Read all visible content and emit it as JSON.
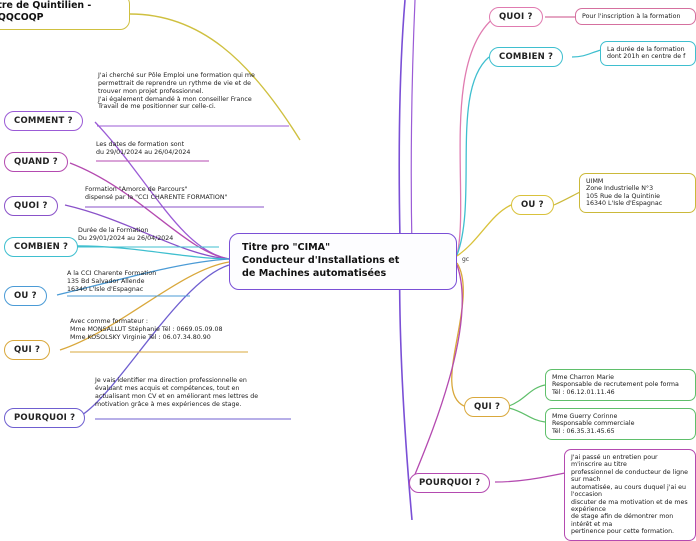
{
  "diagram": {
    "root": {
      "text": "ètre de Quintilien -\n  CQQCOQP"
    },
    "central": {
      "text": "Titre pro \"CIMA\"\nConducteur d'Installations et\nde Machines automatisées"
    },
    "marker": {
      "text": "gc"
    },
    "left_branches": [
      {
        "label": "COMMENT ?",
        "color": "#9b5bd6",
        "detail": "J'ai cherché sur Pôle Emploi une formation qui me\npermettrait de reprendre un rythme de vie et de\ntrouver mon projet professionnel.\nJ'ai également demandé à mon conseiller France\nTravail de me positionner sur celle-ci."
      },
      {
        "label": "QUAND ?",
        "color": "#b44ab0",
        "detail": "Les dates de formation sont\ndu 29/01/2024 au 26/04/2024"
      },
      {
        "label": "QUOI ?",
        "color": "#8a52c9",
        "detail": "Formation \"Amorce de Parcours\"\ndispensé par la \"CCI CHARENTE FORMATION\""
      },
      {
        "label": "COMBIEN ?",
        "color": "#3fbfcf",
        "detail": "Durée de la Formation\nDu 29/01/2024 au 26/04/2024"
      },
      {
        "label": "OU ?",
        "color": "#4b9bd6",
        "detail": "A la CCI Charente Formation\n135 Bd Salvador Allende\n16340 L'Isle d'Espagnac"
      },
      {
        "label": "QUI ?",
        "color": "#d9a83c",
        "detail": "Avec comme formateur :\nMme MONSALLUT Stéphanie Tél : 0669.05.09.08\nMme KOSOLSKY Virginie Tél : 06.07.34.80.90"
      },
      {
        "label": "POURQUOI ?",
        "color": "#6f5fd0",
        "detail": "Je vais identifier ma direction professionnelle en\névaluant mes acquis et compétences, tout en\nactualisant mon CV et en améliorant mes lettres de\nmotivation grâce à mes expériences de stage."
      }
    ],
    "right_branches": [
      {
        "label": "QUOI ?",
        "color": "#e07bb0",
        "cards": [
          {
            "text": "Pour l'inscription à la formation",
            "color": "#d5709f"
          }
        ]
      },
      {
        "label": "COMBIEN ?",
        "color": "#3fbfcf",
        "cards": [
          {
            "text": "La durée de la formation\ndont 201h en centre de f",
            "color": "#3fbfcf"
          }
        ]
      },
      {
        "label": "OU ?",
        "color": "#d9c23c",
        "cards": [
          {
            "text": "UIMM\nZone Industrielle N°3\n105 Rue de la Quintinie\n16340 L'Isle d'Espagnac",
            "color": "#cbb93a",
            "bold_first": true
          }
        ]
      },
      {
        "label": "QUI ?",
        "color": "#d9a83c",
        "cards": [
          {
            "text": "Mme Charron Marie\nResponsable de recrutement pole forma\nTél : 06.12.01.11.46",
            "color": "#5fbf6b"
          },
          {
            "text": "Mme Guerry Corinne\nResponsable commerciale\nTél : 06.35.31.45.65",
            "color": "#5fbf6b"
          }
        ]
      },
      {
        "label": "POURQUOI ?",
        "color": "#b44ab0",
        "cards": [
          {
            "text": "J'ai passé un entretien pour m'inscrire au titre\nprofessionnel de conducteur de ligne sur mach\nautomatisée, au cours duquel j'ai eu l'occasion\ndiscuter de ma motivation et de mes expérience\nde stage afin de démontrer mon intérêt et ma\npertinence pour cette formation.",
            "color": "#b44ab0"
          }
        ]
      }
    ]
  }
}
